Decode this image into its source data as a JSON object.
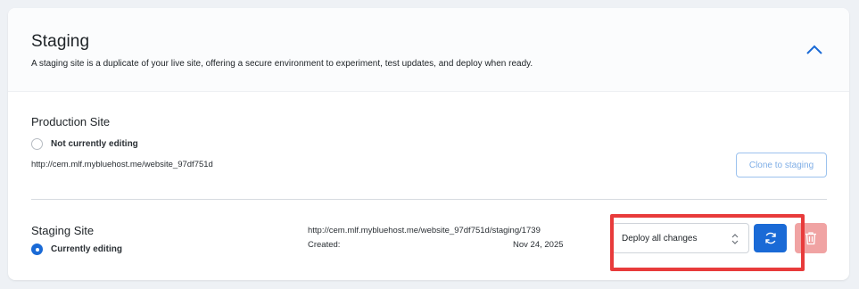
{
  "header": {
    "title": "Staging",
    "description": "A staging site is a duplicate of your live site, offering a secure environment to experiment, test updates, and deploy when ready.",
    "collapse_icon": "chevron-up-icon"
  },
  "production": {
    "title": "Production Site",
    "status_label": "Not currently editing",
    "status_checked": false,
    "url": "http://cem.mlf.mybluehost.me/website_97df751d",
    "clone_button_label": "Clone to staging"
  },
  "staging": {
    "title": "Staging Site",
    "status_label": "Currently editing",
    "status_checked": true,
    "url": "http://cem.mlf.mybluehost.me/website_97df751d/staging/1739",
    "created_label": "Created:",
    "created_date": "Nov 24, 2025",
    "deploy_select_value": "Deploy all changes",
    "deploy_icon": "refresh-icon",
    "delete_icon": "trash-icon"
  },
  "colors": {
    "accent": "#1a6ad6",
    "danger_disabled": "#f0a3a3",
    "highlight": "#e83b3b"
  }
}
